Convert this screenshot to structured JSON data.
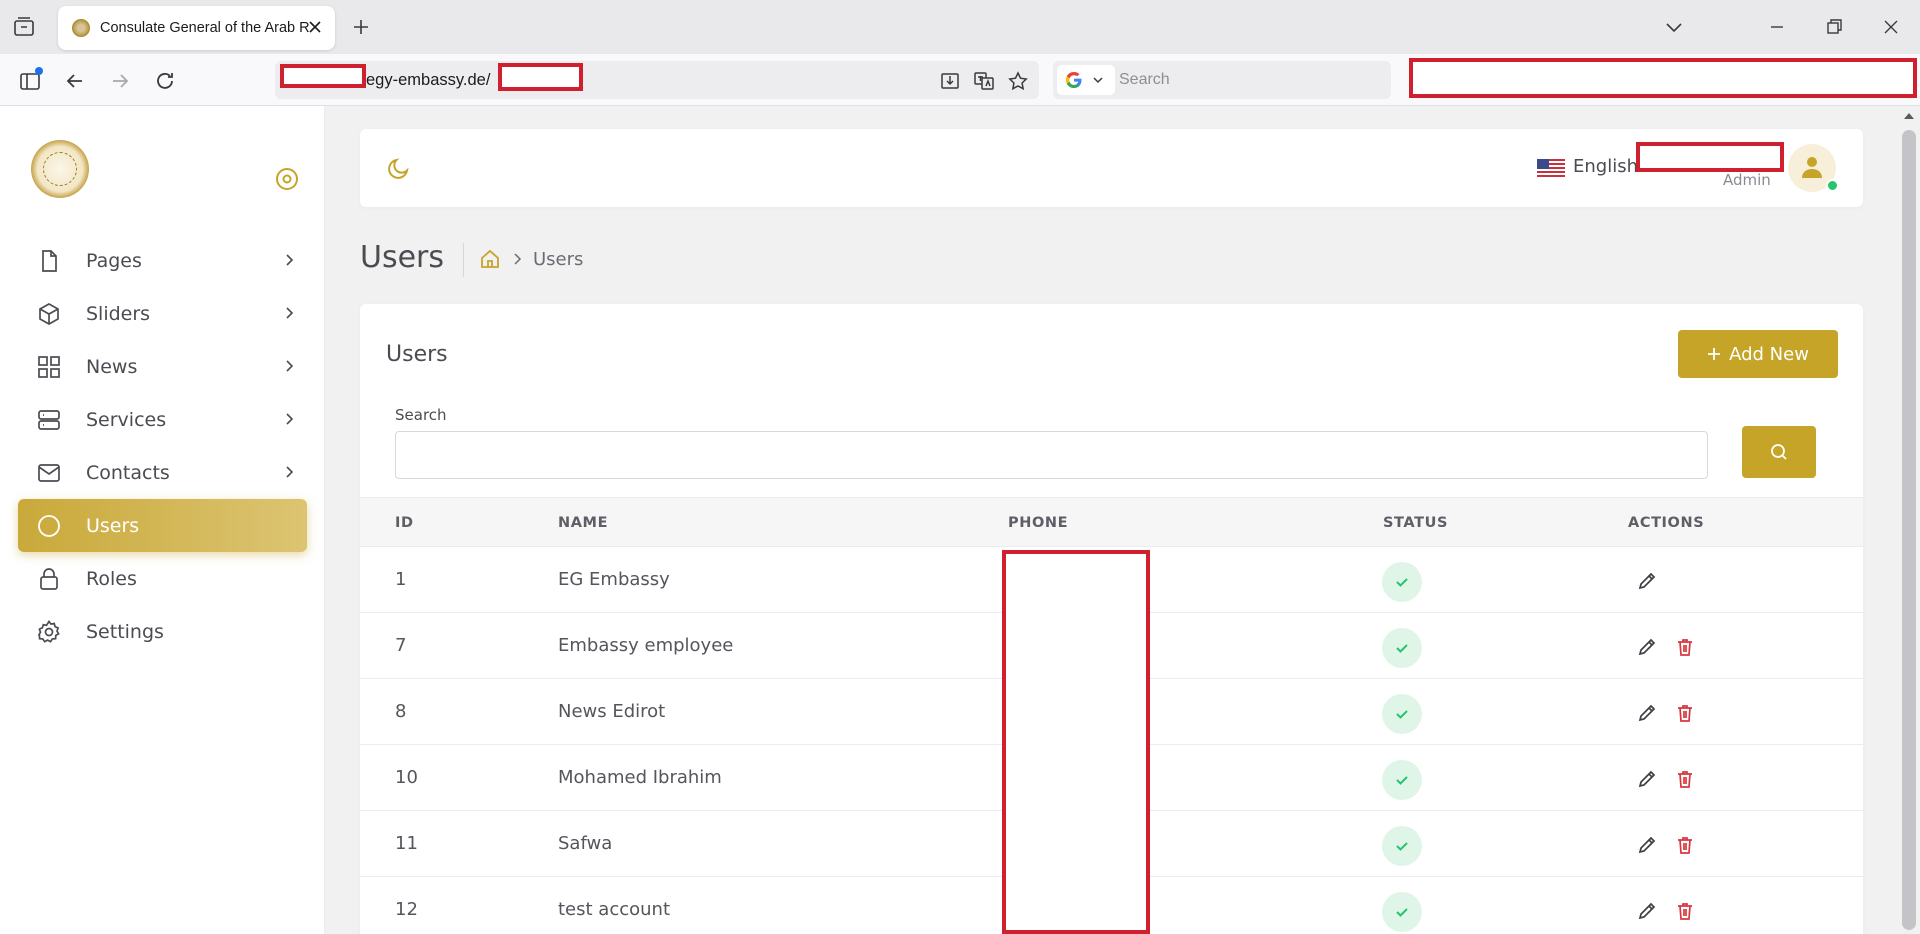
{
  "browser": {
    "tab_title": "Consulate General of the Arab Republic of Egypt",
    "url_visible": "egy-embassy.de/",
    "search_placeholder": "Search"
  },
  "sidebar": {
    "items": [
      {
        "label": "Pages",
        "icon": "file-icon",
        "has_submenu": true,
        "active": false
      },
      {
        "label": "Sliders",
        "icon": "box-icon",
        "has_submenu": true,
        "active": false
      },
      {
        "label": "News",
        "icon": "grid-icon",
        "has_submenu": true,
        "active": false
      },
      {
        "label": "Services",
        "icon": "server-icon",
        "has_submenu": true,
        "active": false
      },
      {
        "label": "Contacts",
        "icon": "mail-icon",
        "has_submenu": true,
        "active": false
      },
      {
        "label": "Users",
        "icon": "circle-icon",
        "has_submenu": false,
        "active": true
      },
      {
        "label": "Roles",
        "icon": "lock-icon",
        "has_submenu": false,
        "active": false
      },
      {
        "label": "Settings",
        "icon": "gear-icon",
        "has_submenu": false,
        "active": false
      }
    ]
  },
  "topbar": {
    "language": "English",
    "user_role": "Admin"
  },
  "page": {
    "title": "Users",
    "breadcrumb_current": "Users"
  },
  "card": {
    "title": "Users",
    "add_button": "Add New",
    "search_label": "Search"
  },
  "table": {
    "headers": {
      "id": "ID",
      "name": "NAME",
      "phone": "PHONE",
      "status": "STATUS",
      "actions": "ACTIONS"
    },
    "rows": [
      {
        "id": "1",
        "name": "EG Embassy",
        "status": "active",
        "deletable": false
      },
      {
        "id": "7",
        "name": "Embassy employee",
        "status": "active",
        "deletable": true
      },
      {
        "id": "8",
        "name": "News Edirot",
        "status": "active",
        "deletable": true
      },
      {
        "id": "10",
        "name": "Mohamed Ibrahim",
        "status": "active",
        "deletable": true
      },
      {
        "id": "11",
        "name": "Safwa",
        "status": "active",
        "deletable": true
      },
      {
        "id": "12",
        "name": "test account",
        "status": "active",
        "deletable": true
      }
    ]
  },
  "colors": {
    "accent": "#c6a428",
    "status_ok": "#27c46e",
    "delete": "#d9363e",
    "redaction": "#d0202f"
  }
}
